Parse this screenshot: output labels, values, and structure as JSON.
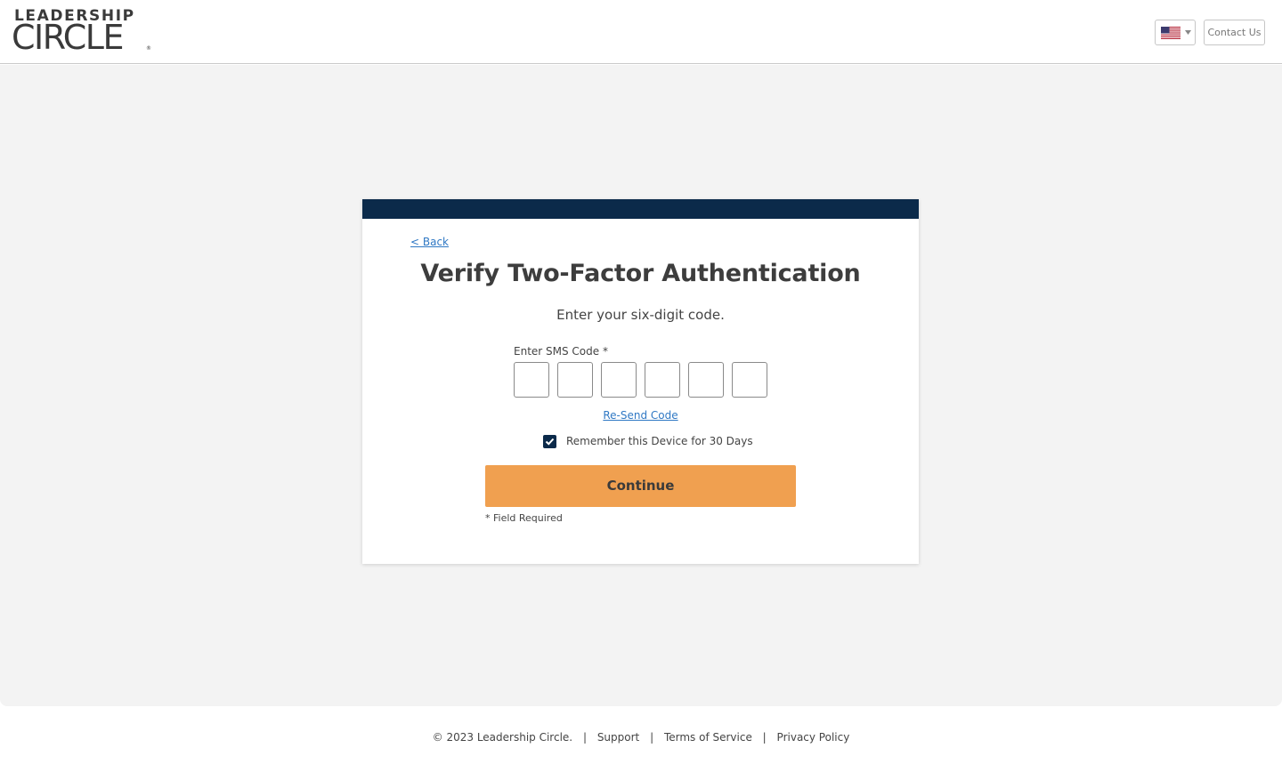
{
  "header": {
    "logo_top": "LEADERSHIP",
    "logo_bottom": "CIRCLE",
    "logo_reg": "®",
    "language_flag": "us-flag-icon",
    "contact_label": "Contact Us"
  },
  "card": {
    "accent_color": "#0b2a4a",
    "back_label": "< Back",
    "title": "Verify Two-Factor Authentication",
    "subtitle": "Enter your six-digit code.",
    "code_label": "Enter SMS Code *",
    "code_digits": [
      "",
      "",
      "",
      "",
      "",
      ""
    ],
    "resend_label": "Re-Send Code",
    "remember_label": "Remember this Device for 30 Days",
    "remember_checked": true,
    "continue_label": "Continue",
    "continue_color": "#f0a050",
    "required_note": "* Field Required"
  },
  "footer": {
    "copyright": "© 2023 Leadership Circle.",
    "separator": "|",
    "support": "Support",
    "terms": "Terms of Service",
    "privacy": "Privacy Policy"
  }
}
